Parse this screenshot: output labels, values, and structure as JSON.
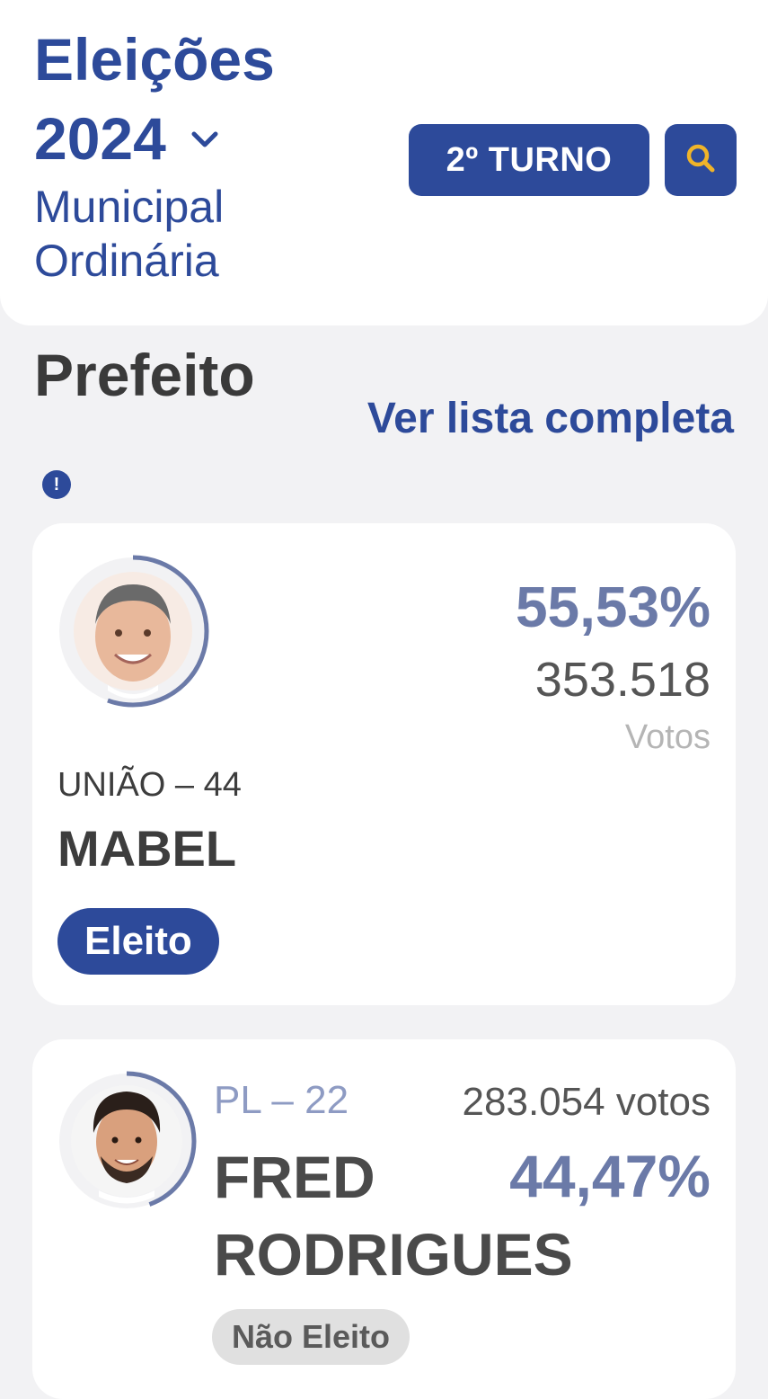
{
  "header": {
    "title": "Eleições",
    "year": "2024",
    "subtitle": "Municipal Ordinária",
    "round_button": "2º TURNO"
  },
  "section": {
    "title": "Prefeito",
    "see_all": "Ver lista completa",
    "info_icon_symbol": "!"
  },
  "candidates": [
    {
      "party": "UNIÃO – 44",
      "name": "MABEL",
      "percent": "55,53%",
      "percent_value": 55.53,
      "votes": "353.518",
      "votes_label": "Votos",
      "status": "Eleito"
    },
    {
      "party": "PL – 22",
      "name": "FRED RODRIGUES",
      "percent": "44,47%",
      "percent_value": 44.47,
      "votes": "283.054 votos",
      "status": "Não Eleito"
    }
  ],
  "colors": {
    "brand_blue": "#2d4a9a",
    "percent_blue": "#6b7aa8",
    "search_icon": "#f0b429",
    "background": "#f2f2f4"
  },
  "icons": [
    "chevron-down-icon",
    "search-icon",
    "info-icon"
  ]
}
